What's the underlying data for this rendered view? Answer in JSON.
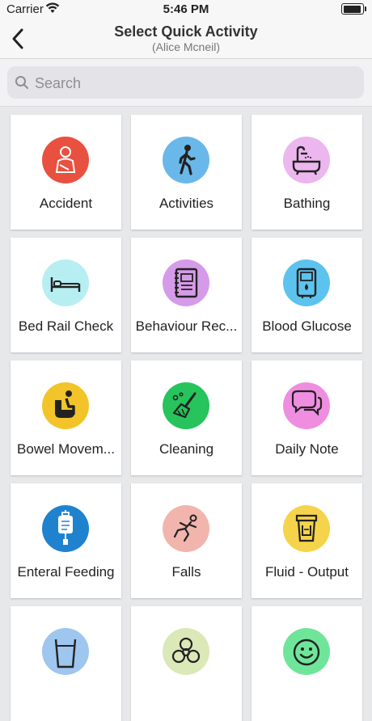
{
  "status_bar": {
    "carrier": "Carrier",
    "time": "5:46 PM",
    "battery_level": 1.0
  },
  "nav": {
    "title": "Select Quick Activity",
    "subtitle": "(Alice Mcneil)"
  },
  "search": {
    "placeholder": "Search",
    "value": ""
  },
  "activities": [
    {
      "label": "Accident",
      "icon": "accident-icon",
      "color": "#e8513f"
    },
    {
      "label": "Activities",
      "icon": "walking-person-icon",
      "color": "#6ab8ea"
    },
    {
      "label": "Bathing",
      "icon": "bathtub-icon",
      "color": "#ecb6ee"
    },
    {
      "label": "Bed Rail Check",
      "icon": "bed-icon",
      "color": "#b7eef2"
    },
    {
      "label": "Behaviour Rec...",
      "icon": "notebook-icon",
      "color": "#d69be8"
    },
    {
      "label": "Blood Glucose",
      "icon": "glucose-meter-icon",
      "color": "#5cc3ee"
    },
    {
      "label": "Bowel Movem...",
      "icon": "toilet-icon",
      "color": "#f2c42a"
    },
    {
      "label": "Cleaning",
      "icon": "broom-icon",
      "color": "#27c35c"
    },
    {
      "label": "Daily Note",
      "icon": "speech-bubbles-icon",
      "color": "#ef8ee0"
    },
    {
      "label": "Enteral Feeding",
      "icon": "iv-bag-icon",
      "color": "#1f82cf"
    },
    {
      "label": "Falls",
      "icon": "falling-person-icon",
      "color": "#f1b5ae"
    },
    {
      "label": "Fluid - Output",
      "icon": "container-icon",
      "color": "#f5d34a"
    },
    {
      "label": "",
      "icon": "glass-icon",
      "color": "#9ec6ee"
    },
    {
      "label": "",
      "icon": "biohazard-icon",
      "color": "#dbe8b7"
    },
    {
      "label": "",
      "icon": "smiley-icon",
      "color": "#6fe59a"
    }
  ]
}
